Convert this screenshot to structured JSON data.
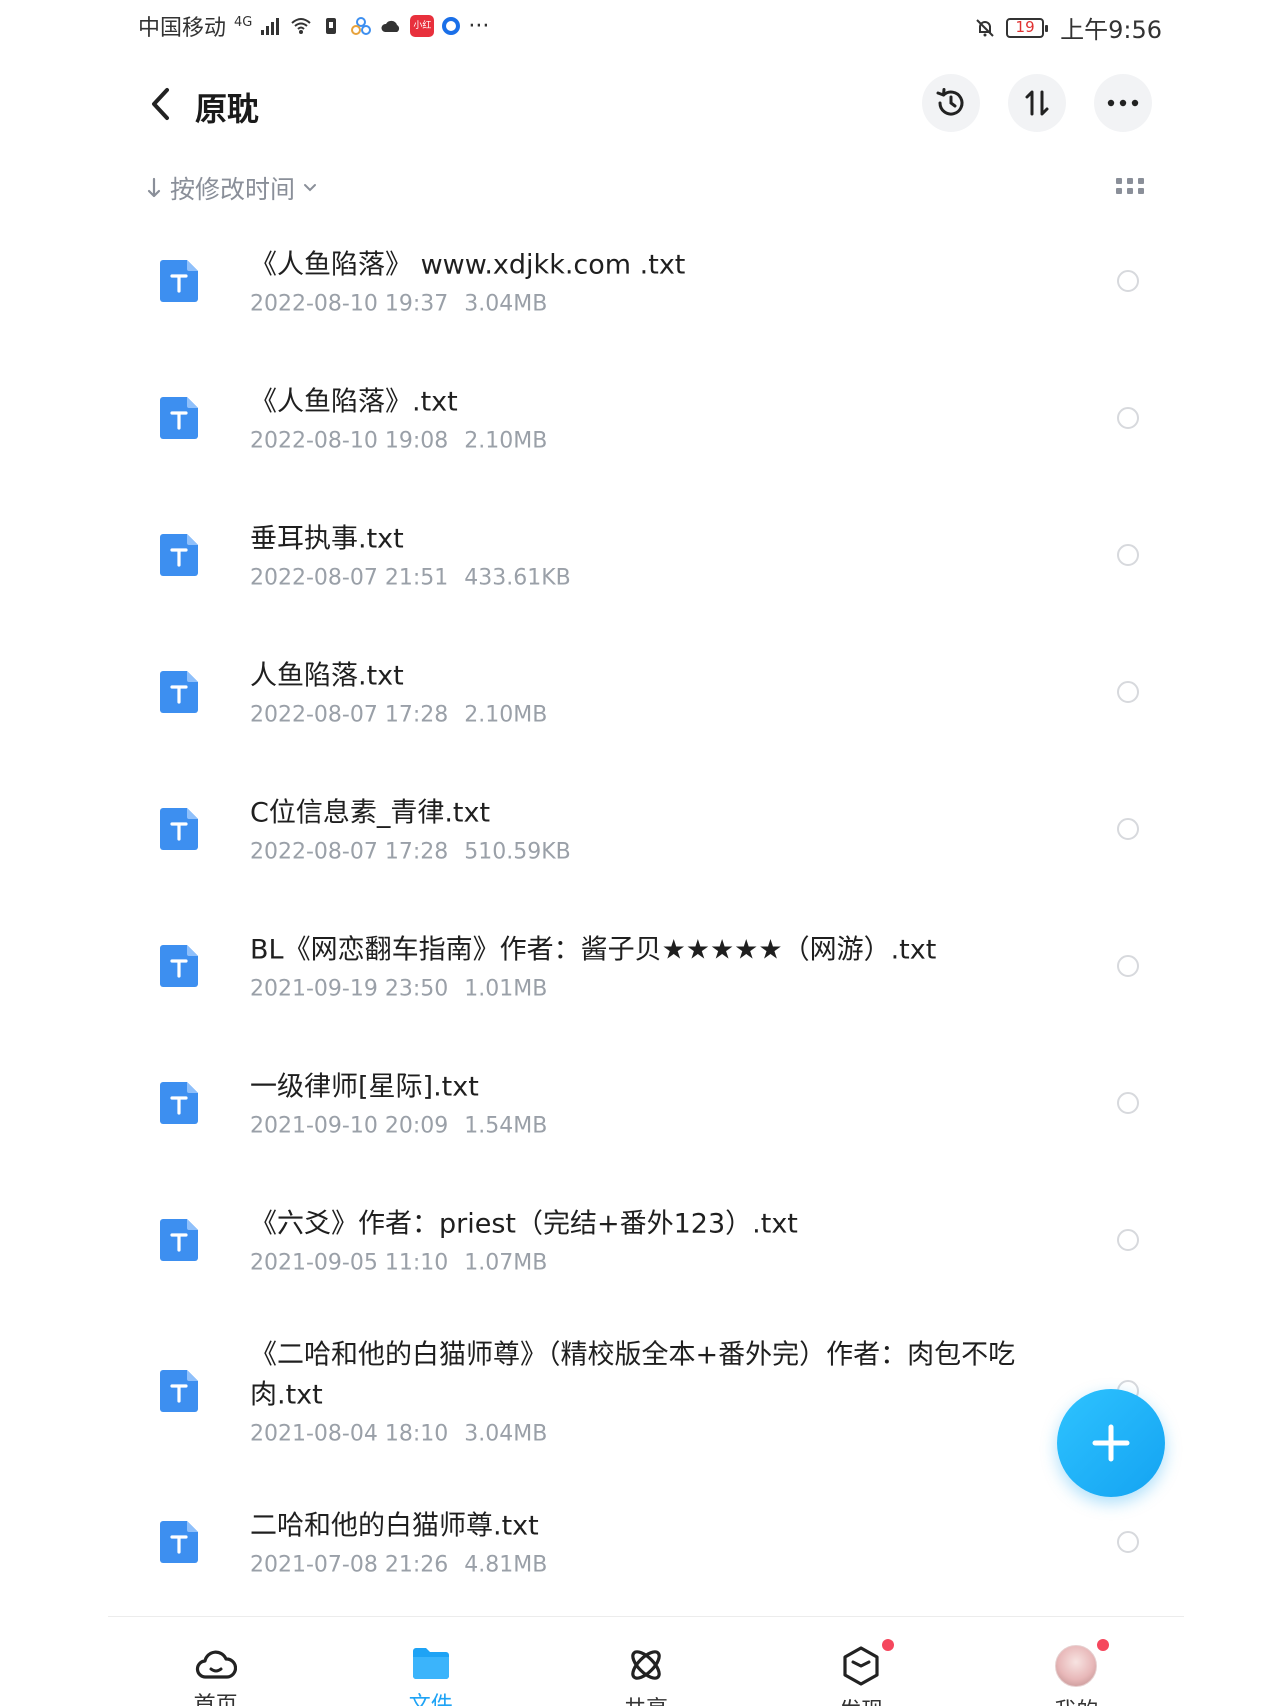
{
  "status_bar": {
    "carrier": "中国移动",
    "network": "4G",
    "app_badge": "小红书",
    "more": "···",
    "battery": "19",
    "time": "上午9:56"
  },
  "header": {
    "title": "原耽"
  },
  "sort": {
    "label": "按修改时间"
  },
  "files": [
    {
      "name": "《人鱼陷落》 www.xdjkk.com .txt",
      "date": "2022-08-10 19:37",
      "size": "3.04MB"
    },
    {
      "name": "《人鱼陷落》.txt",
      "date": "2022-08-10 19:08",
      "size": "2.10MB"
    },
    {
      "name": "垂耳执事.txt",
      "date": "2022-08-07 21:51",
      "size": "433.61KB"
    },
    {
      "name": "人鱼陷落.txt",
      "date": "2022-08-07 17:28",
      "size": "2.10MB"
    },
    {
      "name": "C位信息素_青律.txt",
      "date": "2022-08-07 17:28",
      "size": "510.59KB"
    },
    {
      "name": "BL《网恋翻车指南》作者：酱子贝★★★★★（网游）.txt",
      "date": "2021-09-19 23:50",
      "size": "1.01MB"
    },
    {
      "name": "一级律师[星际].txt",
      "date": "2021-09-10 20:09",
      "size": "1.54MB"
    },
    {
      "name": "《六爻》作者：priest（完结+番外123）.txt",
      "date": "2021-09-05 11:10",
      "size": "1.07MB"
    },
    {
      "name": "《二哈和他的白猫师尊》（精校版全本+番外完）作者：肉包不吃肉.txt",
      "date": "2021-08-04 18:10",
      "size": "3.04MB"
    },
    {
      "name": "二哈和他的白猫师尊.txt",
      "date": "2021-07-08 21:26",
      "size": "4.81MB"
    }
  ],
  "nav": [
    {
      "label": "首页",
      "icon": "cloud-icon",
      "active": false
    },
    {
      "label": "文件",
      "icon": "folder-icon",
      "active": true
    },
    {
      "label": "共享",
      "icon": "share-icon",
      "active": false
    },
    {
      "label": "发现",
      "icon": "discover-icon",
      "active": false
    },
    {
      "label": "我的",
      "icon": "avatar",
      "active": false
    }
  ],
  "colors": {
    "accent": "#1ea3f5",
    "file_icon": "#3d8ff0",
    "badge_red": "#f5475d"
  }
}
